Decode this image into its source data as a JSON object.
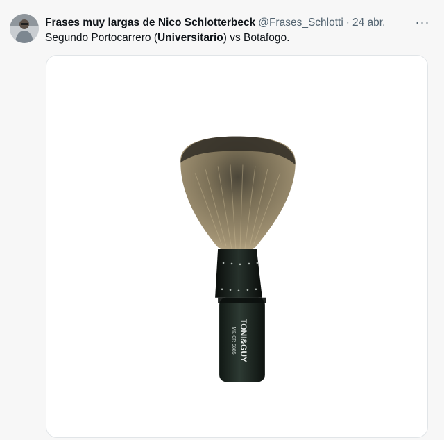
{
  "tweet": {
    "author": {
      "display_name": "Frases muy largas de Nico Schlotterbeck",
      "handle": "@Frases_Schlotti",
      "separator": "·",
      "date": "24 abr."
    },
    "more_label": "···",
    "text": {
      "part1": "Segundo Portocarrero (",
      "bold": "Universitario",
      "part2": ") vs Botafogo."
    },
    "media": {
      "brand_line1": "TONI&GUY",
      "brand_line2": "MK-CR 9885",
      "handle_color": "#1e2a24",
      "bristle_color": "#8b7f63"
    }
  }
}
